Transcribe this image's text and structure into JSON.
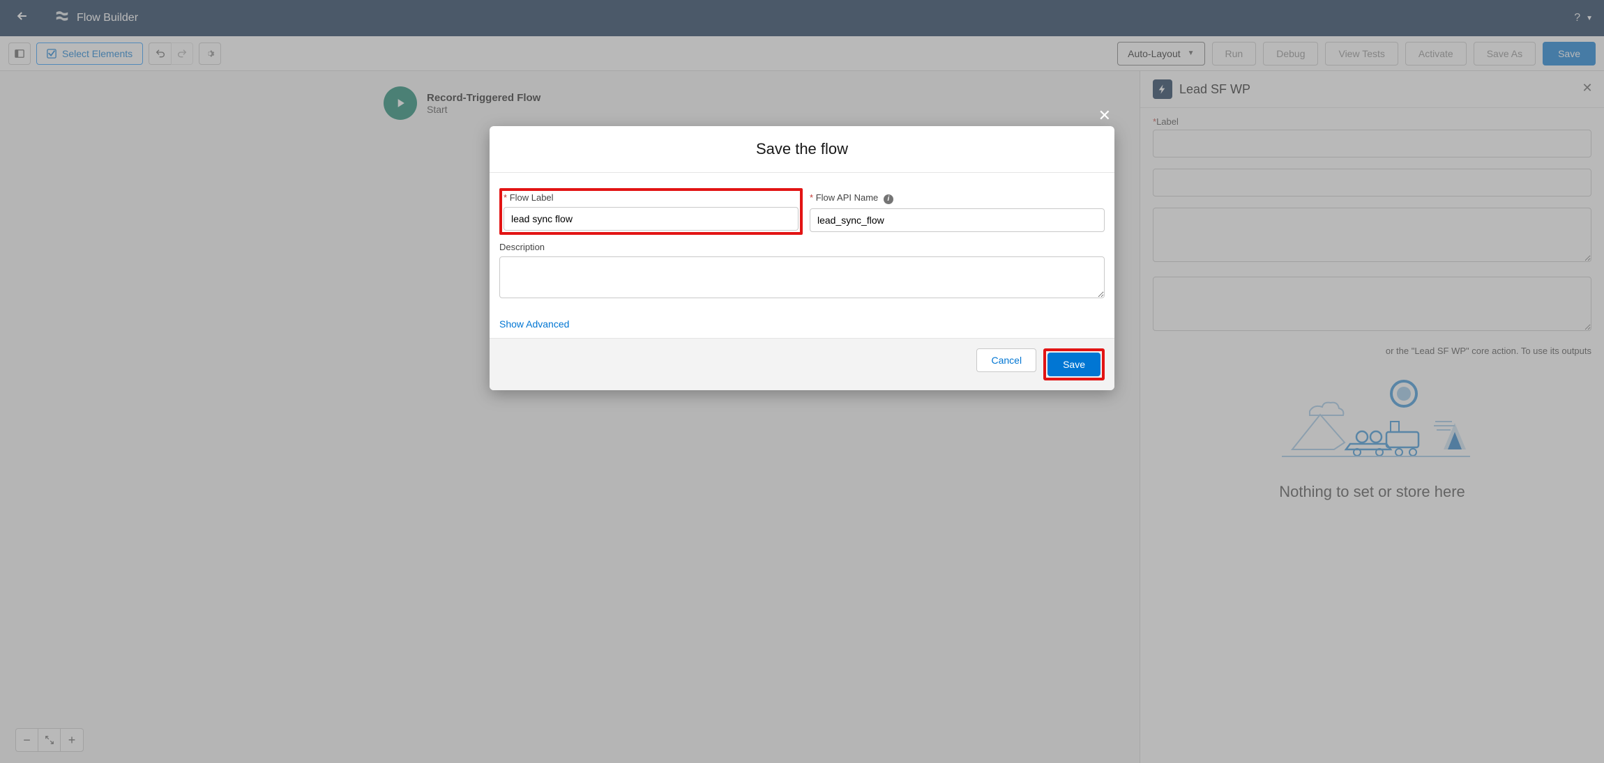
{
  "top_nav": {
    "title": "Flow Builder",
    "help_tooltip": "?"
  },
  "toolbar": {
    "select_elements": "Select Elements",
    "auto_layout": "Auto-Layout",
    "run": "Run",
    "debug": "Debug",
    "view_tests": "View Tests",
    "activate": "Activate",
    "save_as": "Save As",
    "save": "Save"
  },
  "canvas": {
    "node_title": "Record-Triggered Flow",
    "node_subtitle": "Start"
  },
  "panel": {
    "title": "Lead SF WP",
    "label_heading": "Label",
    "description_text": "or the \"Lead SF WP\" core action. To use its outputs",
    "nothing_heading": "Nothing to set or store here"
  },
  "modal": {
    "title": "Save the flow",
    "flow_label": "Flow Label",
    "flow_label_value": "lead sync flow",
    "api_name": "Flow API Name",
    "api_name_value": "lead_sync_flow",
    "description": "Description",
    "description_value": "",
    "show_advanced": "Show Advanced",
    "cancel": "Cancel",
    "save": "Save"
  }
}
